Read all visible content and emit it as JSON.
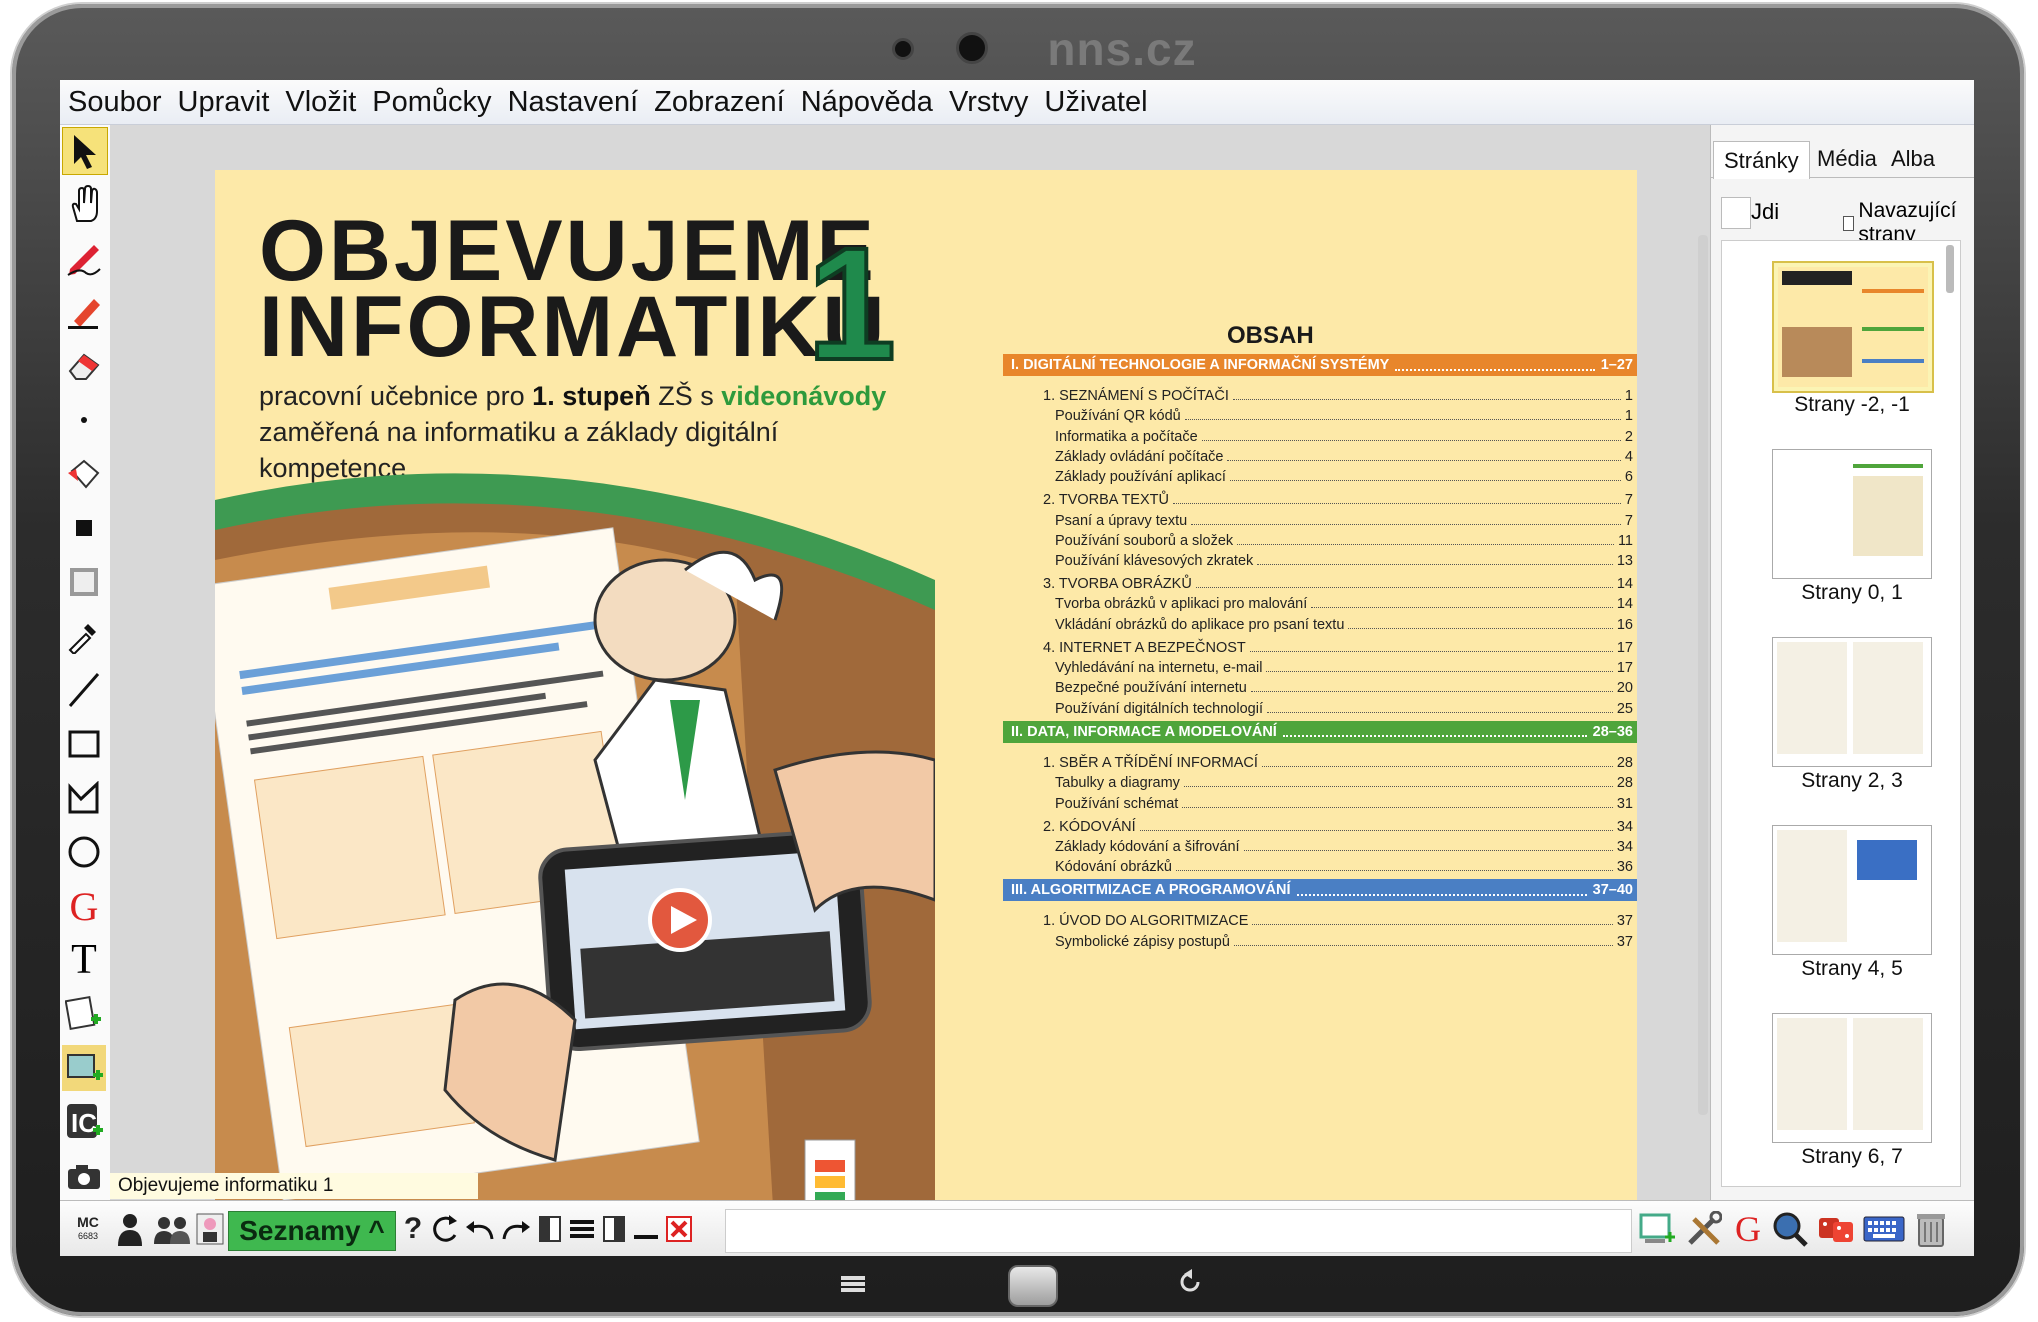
{
  "device": {
    "brand": "nns.cz"
  },
  "menu": [
    "Soubor",
    "Upravit",
    "Vložit",
    "Pomůcky",
    "Nastavení",
    "Zobrazení",
    "Nápověda",
    "Vrstvy",
    "Uživatel"
  ],
  "toolbar": {
    "tools": [
      "select-arrow-icon",
      "hand-icon",
      "pen-icon",
      "highlighter-icon",
      "eraser-icon",
      "dot-icon",
      "fill-bucket-icon",
      "filled-square-icon",
      "hollow-square-icon",
      "eyedropper-icon",
      "line-icon",
      "rectangle-icon",
      "polygon-icon",
      "circle-icon",
      "g-icon",
      "text-icon",
      "add-note-icon",
      "add-image-icon",
      "ic-add-icon",
      "camera-icon"
    ]
  },
  "page": {
    "title_line1": "OBJEVUJEME",
    "title_line2": "INFORMATIKU",
    "title_number": "1",
    "subtitle_part1": "pracovní učebnice pro ",
    "subtitle_bold": "1. stupeň",
    "subtitle_part2": " ZŠ s ",
    "subtitle_green": "videonávody",
    "subtitle_line2": "zaměřená na informatiku a základy digitální kompetence",
    "toc_title": "OBSAH",
    "toc": [
      {
        "type": "head",
        "text": "I. DIGITÁLNÍ TECHNOLOGIE A INFORMAČNÍ SYSTÉMY",
        "page": "1–27",
        "color": "#e8862b"
      },
      {
        "type": "row",
        "text": "1. SEZNÁMENÍ S POČÍTAČI",
        "page": "1"
      },
      {
        "type": "sub",
        "text": "Používání QR kódů",
        "page": "1"
      },
      {
        "type": "sub",
        "text": "Informatika a počítače",
        "page": "2"
      },
      {
        "type": "sub",
        "text": "Základy ovládání počítače",
        "page": "4"
      },
      {
        "type": "sub",
        "text": "Základy používání aplikací",
        "page": "6"
      },
      {
        "type": "row",
        "text": "2. TVORBA TEXTŮ",
        "page": "7"
      },
      {
        "type": "sub",
        "text": "Psaní a úpravy textu",
        "page": "7"
      },
      {
        "type": "sub",
        "text": "Používání souborů a složek",
        "page": "11"
      },
      {
        "type": "sub",
        "text": "Používání klávesových zkratek",
        "page": "13"
      },
      {
        "type": "row",
        "text": "3. TVORBA OBRÁZKŮ",
        "page": "14"
      },
      {
        "type": "sub",
        "text": "Tvorba obrázků v aplikaci pro malování",
        "page": "14"
      },
      {
        "type": "sub",
        "text": "Vkládání obrázků do aplikace pro psaní textu",
        "page": "16"
      },
      {
        "type": "row",
        "text": "4. INTERNET A BEZPEČNOST",
        "page": "17"
      },
      {
        "type": "sub",
        "text": "Vyhledávání na internetu, e-mail",
        "page": "17"
      },
      {
        "type": "sub",
        "text": "Bezpečné používání internetu",
        "page": "20"
      },
      {
        "type": "sub",
        "text": "Používání digitálních technologií",
        "page": "25"
      },
      {
        "type": "head",
        "text": "II. DATA, INFORMACE A MODELOVÁNÍ",
        "page": "28–36",
        "color": "#4fa53b"
      },
      {
        "type": "row",
        "text": "1. SBĚR A TŘÍDĚNÍ INFORMACÍ",
        "page": "28"
      },
      {
        "type": "sub",
        "text": "Tabulky a diagramy",
        "page": "28"
      },
      {
        "type": "sub",
        "text": "Používání schémat",
        "page": "31"
      },
      {
        "type": "row",
        "text": "2. KÓDOVÁNÍ",
        "page": "34"
      },
      {
        "type": "sub",
        "text": "Základy kódování a šifrování",
        "page": "34"
      },
      {
        "type": "sub",
        "text": "Kódování obrázků",
        "page": "36"
      },
      {
        "type": "head",
        "text": "III. ALGORITMIZACE A PROGRAMOVÁNÍ",
        "page": "37–40",
        "color": "#4a7fc4"
      },
      {
        "type": "row",
        "text": "1. ÚVOD DO ALGORITMIZACE",
        "page": "37"
      },
      {
        "type": "sub",
        "text": "Symbolické zápisy postupů",
        "page": "37"
      }
    ]
  },
  "right_panel": {
    "tabs": [
      "Stránky",
      "Média",
      "Alba"
    ],
    "go_label": "Jdi",
    "continuous_label": "Navazující strany",
    "thumbs": [
      "Strany -2, -1",
      "Strany 0, 1",
      "Strany 2, 3",
      "Strany 4, 5",
      "Strany 6, 7"
    ]
  },
  "status": {
    "doc_name": "Objevujeme informatiku 1"
  },
  "bottom": {
    "mc_label": "MC",
    "mc_number": "6683",
    "seznamy_label": "Seznamy ^",
    "help_label": "?"
  }
}
